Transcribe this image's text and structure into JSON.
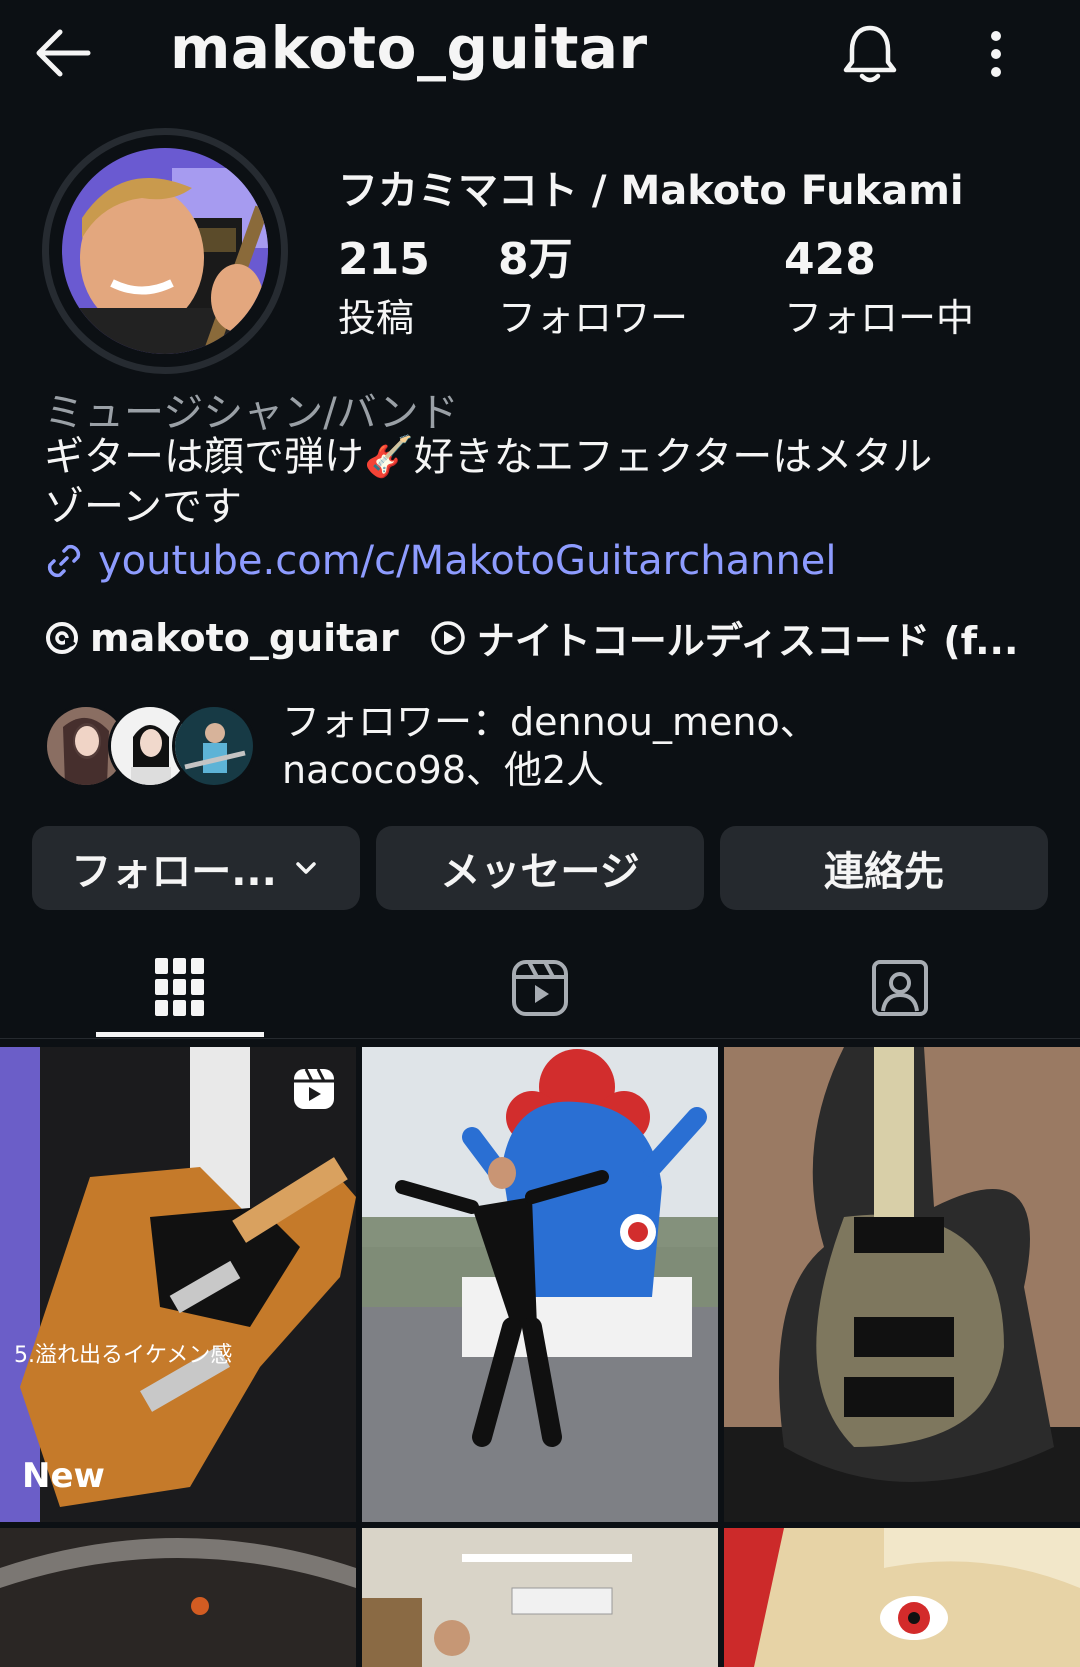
{
  "header": {
    "username": "makoto_guitar",
    "back_icon": "arrow-left-icon",
    "bell_icon": "bell-icon",
    "more_icon": "more-vertical-icon"
  },
  "profile": {
    "display_name": "フカミマコト / Makoto Fukami",
    "stats": [
      {
        "value": "215",
        "label": "投稿"
      },
      {
        "value": "8万",
        "label": "フォロワー"
      },
      {
        "value": "428",
        "label": "フォロー中"
      }
    ],
    "category": "ミュージシャン/バンド",
    "bio_part1": "ギターは顔で弾け",
    "bio_emoji": "🎸",
    "bio_part2": "好きなエフェクターはメタル",
    "bio_line2": "ゾーンです",
    "link": "youtube.com/c/MakotoGuitarchannel",
    "threads_handle": "makoto_guitar",
    "music_chip": "ナイトコールディスコード (f..."
  },
  "followed_by": {
    "line1": "フォロワー：dennou_meno、",
    "line2": "nacoco98、他2人"
  },
  "buttons": {
    "following": "フォロー...",
    "message": "メッセージ",
    "contact": "連絡先"
  },
  "grid": {
    "tile1_caption": "5.溢れ出るイケメン感",
    "tile1_badge": "New"
  },
  "colors": {
    "background": "#0c1014",
    "button": "#25292e",
    "link": "#8e9cff"
  }
}
